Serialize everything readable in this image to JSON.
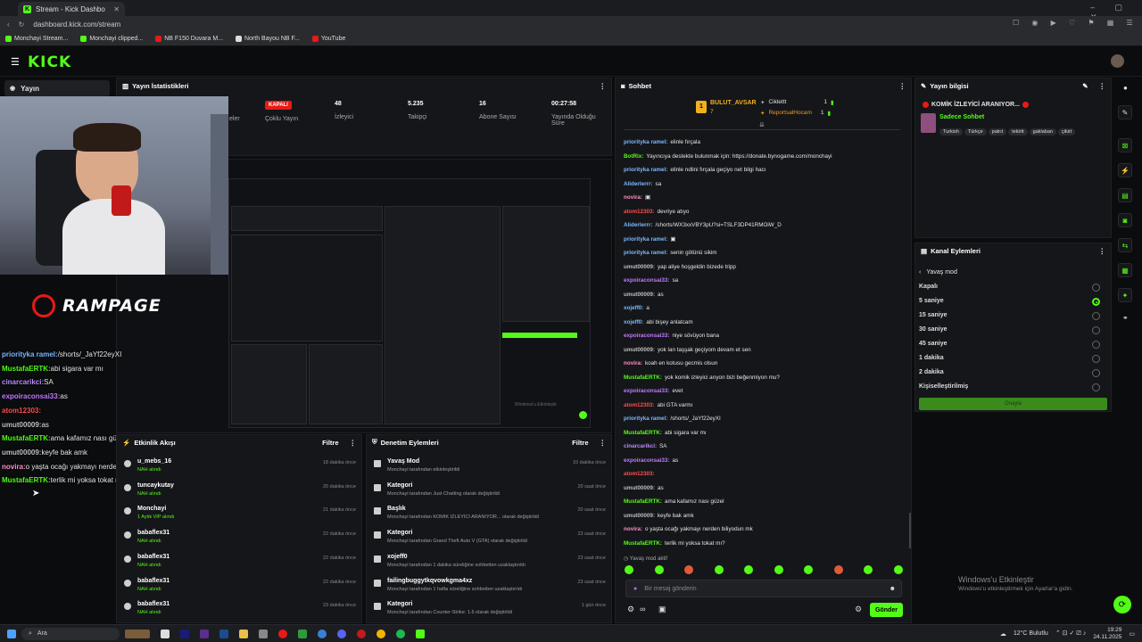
{
  "browser": {
    "tab_title": "Stream - Kick Dashbo",
    "url": "dashboard.kick.com/stream",
    "bookmarks": [
      "Monchayi Stream...",
      "Monchayi clipped...",
      "NB F150 Duvara M...",
      "North Bayou NB F...",
      "YouTube"
    ]
  },
  "app": {
    "logo": "KICK",
    "sidebar_item": "Yayın"
  },
  "stats": {
    "title": "Yayın İstatistikleri",
    "status_badge": "KAPALI",
    "multi_stream": "Çoklu Yayın",
    "viewers_value": "48",
    "viewers_label": "İzleyici",
    "followers_value": "5.235",
    "followers_label": "Takipçi",
    "subs_value": "16",
    "subs_label": "Abone Sayısı",
    "duration_value": "00:27:58",
    "duration_label_1": "Yayında Olduğu",
    "duration_label_2": "Süre",
    "hidden_label": "eler"
  },
  "webcam_overlay": {
    "brand": "RAMPAGE",
    "chat": [
      {
        "user": "priorityka ramel:",
        "text": "/shorts/_JaYf22eyXI",
        "color": "#7ab8ff"
      },
      {
        "user": "MustafaERTK:",
        "text": "abi sigara var mı",
        "color": "#53fc18"
      },
      {
        "user": "cinarcarikci:",
        "text": "SA",
        "color": "#b88cff"
      },
      {
        "user": "expoiraconsai33:",
        "text": "as",
        "color": "#c17aff"
      },
      {
        "user": "atom12303:",
        "text": "",
        "color": "#ff4d4d"
      },
      {
        "user": "umut00009:",
        "text": "as",
        "color": "#bfbfbf"
      },
      {
        "user": "MustafaERTK:",
        "text": "ama kafamız nası güzel",
        "color": "#53fc18"
      },
      {
        "user": "umut00009:",
        "text": "keyfe bak amk",
        "color": "#bfbfbf"
      },
      {
        "user": "novira:",
        "text": "o yaşta ocağı yakmayı nerden biliyodun mk",
        "color": "#ff8fc8"
      },
      {
        "user": "MustafaERTK:",
        "text": "terlik mi yoksa tokat mı?",
        "color": "#53fc18"
      }
    ]
  },
  "activity": {
    "title": "Etkinlik Akışı",
    "filter": "Filtre",
    "items": [
      {
        "name": "u_mebs_16",
        "detail": "NAH alındı",
        "time": "18 dakika önce"
      },
      {
        "name": "tuncaykutay",
        "detail": "NAH alındı",
        "time": "20 dakika önce"
      },
      {
        "name": "Monchayi",
        "detail": "1 Aylık VIP alındı",
        "time": "21 dakika önce"
      },
      {
        "name": "babaflex31",
        "detail": "NAH alındı",
        "time": "22 dakika önce"
      },
      {
        "name": "babaflex31",
        "detail": "NAH alındı",
        "time": "22 dakika önce"
      },
      {
        "name": "babaflex31",
        "detail": "NAH alındı",
        "time": "22 dakika önce"
      },
      {
        "name": "babaflex31",
        "detail": "NAH alındı",
        "time": "23 dakika önce"
      }
    ]
  },
  "moderation": {
    "title": "Denetim Eylemleri",
    "filter": "Filtre",
    "items": [
      {
        "name": "Yavaş Mod",
        "detail": "Monchayi tarafından etkinleştirildi",
        "time": "10 dakika önce"
      },
      {
        "name": "Kategori",
        "detail": "Monchayi tarafından Just Chatting olarak değiştirildi",
        "time": "20 saat önce"
      },
      {
        "name": "Başlık",
        "detail": "Monchayi tarafından KOMİK İZLEYİCİ ARANIYOR... olarak değiştirildi",
        "time": "20 saat önce"
      },
      {
        "name": "Kategori",
        "detail": "Monchayi tarafından Grand Theft Auto V (GTA) olarak değiştirildi",
        "time": "23 saat önce"
      },
      {
        "name": "xojeff0",
        "detail": "Monchayi tarafından 1 dakika süreliğine sohbetten uzaklaştırıldı",
        "time": "23 saat önce"
      },
      {
        "name": "failingbuggytkqvowkgma4xz",
        "detail": "Monchayi tarafından 1 hafta süreliğine sohbetten uzaklaştırıldı",
        "time": "23 saat önce"
      },
      {
        "name": "Kategori",
        "detail": "Monchayi tarafından Counter-Strike: 1.6 olarak değiştirildi",
        "time": "1 gün önce"
      }
    ]
  },
  "chat": {
    "title": "Sohbet",
    "pinned_user": "BULUT_AVSAR",
    "pinned_count": "7",
    "top1": "Ciklettt",
    "top1_n": "1",
    "top2": "ReportsalHocam",
    "top2_n": "1",
    "messages": [
      {
        "user": "priorityka ramel:",
        "text": "elinle fırçala",
        "color": "#7ab8ff"
      },
      {
        "user": "BotRix:",
        "text": "Yayıncıya destekte bulunmak için: https://donate.bynogame.com/monchayi",
        "color": "#53fc18"
      },
      {
        "user": "priorityka ramel:",
        "text": "elinle ndlini fırçala geçiyo net bilgi hacı",
        "color": "#7ab8ff"
      },
      {
        "user": "Aliderlerrr:",
        "text": "sa",
        "color": "#7ab8ff"
      },
      {
        "user": "novira:",
        "text": "▣",
        "color": "#ff8fc8"
      },
      {
        "user": "atom12303:",
        "text": "devriye atıyo",
        "color": "#ff4d4d"
      },
      {
        "user": "Aliderlerrr:",
        "text": "/shorts/WX3xxVBY3pU?si=TSLF3DP41RMOiW_D",
        "color": "#7ab8ff"
      },
      {
        "user": "priorityka ramel:",
        "text": "▣",
        "color": "#7ab8ff"
      },
      {
        "user": "priorityka ramel:",
        "text": "senin götünü sikim",
        "color": "#7ab8ff"
      },
      {
        "user": "umut00009:",
        "text": "yap aliye hoşgeldin bizede tripp",
        "color": "#bfbfbf"
      },
      {
        "user": "expoiraconsai33:",
        "text": "sa",
        "color": "#c17aff"
      },
      {
        "user": "umut00009:",
        "text": "as",
        "color": "#bfbfbf"
      },
      {
        "user": "xojeff0:",
        "text": "a",
        "color": "#7ab8ff"
      },
      {
        "user": "xojeff0:",
        "text": "abi bişey anlatcam",
        "color": "#7ab8ff"
      },
      {
        "user": "expoiraconsai33:",
        "text": "niye sövüyon bana",
        "color": "#c17aff"
      },
      {
        "user": "umut00009:",
        "text": "yok lan taşşak geçiyom devam et sen",
        "color": "#bfbfbf"
      },
      {
        "user": "novira:",
        "text": "koah en kotusu gecmis olsun",
        "color": "#ff8fc8"
      },
      {
        "user": "MustafaERTK:",
        "text": "yok komik izleyici arıyon bizi beğenmiyon mu?",
        "color": "#53fc18"
      },
      {
        "user": "expoiraconsai33:",
        "text": "evet",
        "color": "#c17aff"
      },
      {
        "user": "atom12303:",
        "text": "abi GTA varmı",
        "color": "#ff4d4d"
      },
      {
        "user": "priorityka ramel:",
        "text": "/shorts/_JaYf22eyXI",
        "color": "#7ab8ff"
      },
      {
        "user": "MustafaERTK:",
        "text": "abi sigara var mı",
        "color": "#53fc18"
      },
      {
        "user": "cinarcarikci:",
        "text": "SA",
        "color": "#b88cff"
      },
      {
        "user": "expoiraconsai33:",
        "text": "as",
        "color": "#c17aff"
      },
      {
        "user": "atom12303:",
        "text": "",
        "color": "#ff4d4d"
      },
      {
        "user": "umut00009:",
        "text": "as",
        "color": "#bfbfbf"
      },
      {
        "user": "MustafaERTK:",
        "text": "ama kafamız nası güzel",
        "color": "#53fc18"
      },
      {
        "user": "umut00009:",
        "text": "keyfe bak amk",
        "color": "#bfbfbf"
      },
      {
        "user": "novira:",
        "text": "o yaşta ocağı yakmayı nerden biliyodun mk",
        "color": "#ff8fc8"
      },
      {
        "user": "MustafaERTK:",
        "text": "terlik mi yoksa tokat mı?",
        "color": "#53fc18"
      }
    ],
    "slow_mode_notice": "Yavaş mod aktif",
    "input_placeholder": "Bir mesaj gönderin",
    "send": "Gönder"
  },
  "stream_info": {
    "title": "Yayın bilgisi",
    "stream_title": "KOMİK İZLEYİCİ ARANIYOR...",
    "category": "Sadece Sohbet",
    "tags": [
      "Turkish",
      "Türkçe",
      "patrıt",
      "tekirtt",
      "gaklaban",
      "çikirt"
    ]
  },
  "channel_actions": {
    "title": "Kanal Eylemleri",
    "sub_title": "Yavaş mod",
    "options": [
      "Kapalı",
      "5 saniye",
      "15 saniye",
      "30 saniye",
      "45 saniye",
      "1 dakika",
      "2 dakika",
      "Kişiselleştirilmiş"
    ],
    "selected": "5 saniye",
    "confirm": "Onayla"
  },
  "windows": {
    "activate_title": "Windows'u Etkinleştir",
    "activate_sub": "Windows'u etkinleştirmek için Ayarlar'a gidin.",
    "search": "Ara",
    "weather": "12°C Bulutlu",
    "time": "19:29",
    "date": "24.11.2025"
  },
  "colors": {
    "accent": "#53fc18",
    "bg": "#0b0c0e",
    "panel": "#151619",
    "live_badge": "#e91916"
  }
}
